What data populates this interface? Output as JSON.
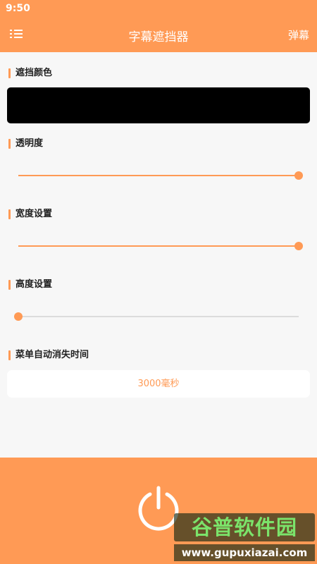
{
  "status_bar": {
    "time": "9:50"
  },
  "app_bar": {
    "title": "字幕遮挡器",
    "action_label": "弹幕",
    "menu_icon": "list-menu-icon"
  },
  "sections": {
    "color": {
      "label": "遮挡颜色",
      "value": "#000000"
    },
    "opacity": {
      "label": "透明度",
      "value_fraction": 1.0
    },
    "width": {
      "label": "宽度设置",
      "value_fraction": 1.0
    },
    "height": {
      "label": "高度设置",
      "value_fraction": 0.0
    },
    "auto_hide": {
      "label": "菜单自动消失时间",
      "value": "3000毫秒"
    }
  },
  "bottom": {
    "power_icon": "power-icon"
  },
  "watermark": {
    "title": "谷普软件园",
    "url": "www.gupuxiazai.com"
  },
  "colors": {
    "accent": "#ff9a55",
    "track": "#dcdcdc",
    "background": "#f7f7f7"
  }
}
